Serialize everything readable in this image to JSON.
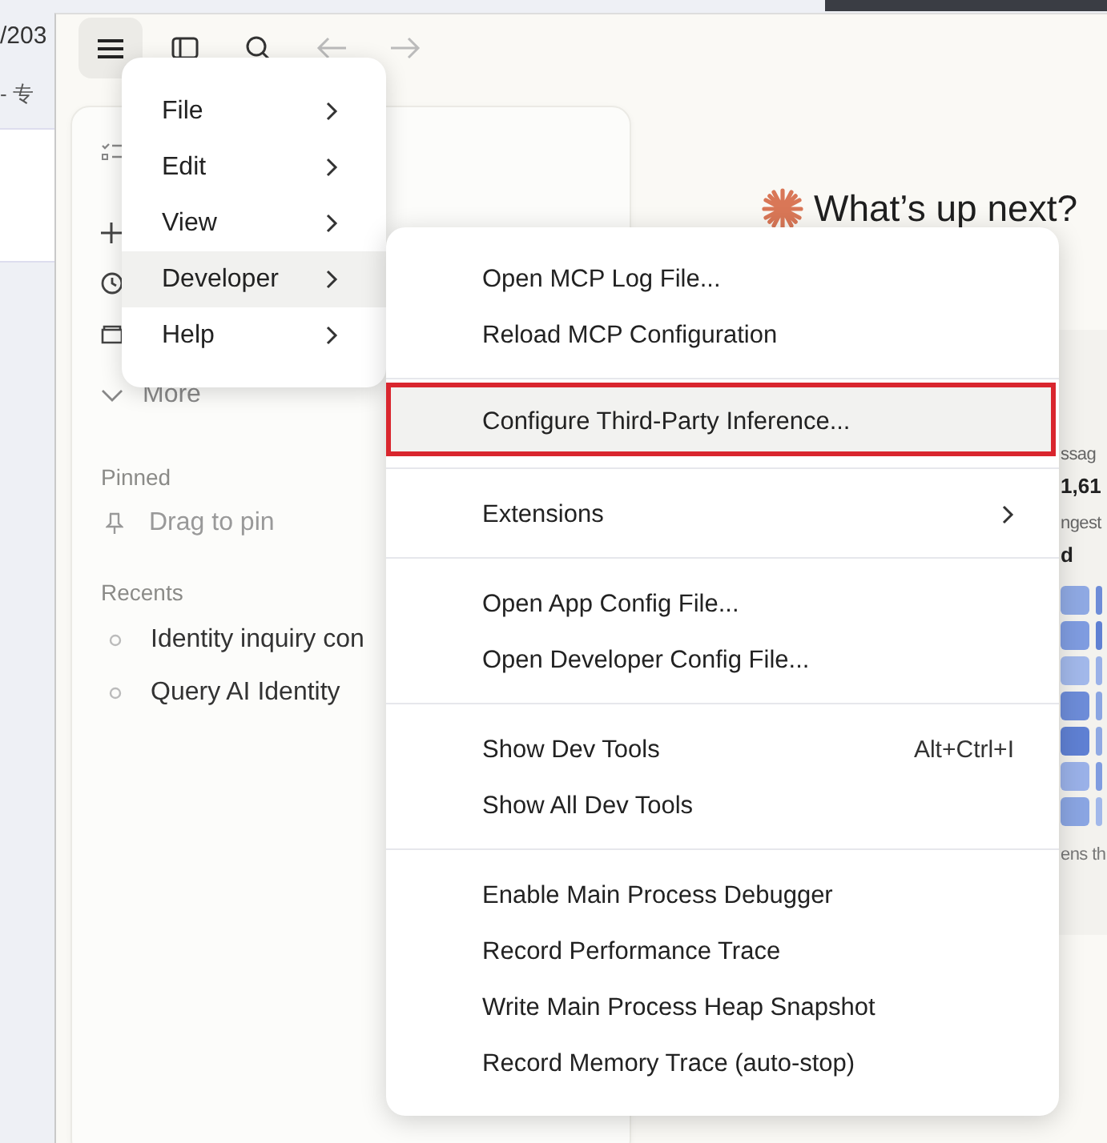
{
  "browser_background": {
    "url_fragment": "/203",
    "tab_fragment": "- 专"
  },
  "sidebar": {
    "more": {
      "label": "More"
    },
    "pinned": {
      "title": "Pinned",
      "hint": "Drag to pin"
    },
    "recents": {
      "title": "Recents",
      "items": [
        {
          "label": "Identity inquiry con"
        },
        {
          "label": "Query AI Identity"
        }
      ]
    }
  },
  "main": {
    "greeting": "What’s up next?",
    "stats_fragments": [
      {
        "text": "ssag",
        "kind": "label"
      },
      {
        "text": "1,61",
        "kind": "value"
      },
      {
        "text": "ngest",
        "kind": "label"
      },
      {
        "text": "d",
        "kind": "value"
      },
      {
        "kind": "heatmap"
      },
      {
        "text": "ens th",
        "kind": "note"
      }
    ]
  },
  "app_menu": {
    "items": [
      {
        "label": "File",
        "selected": false
      },
      {
        "label": "Edit",
        "selected": false
      },
      {
        "label": "View",
        "selected": false
      },
      {
        "label": "Developer",
        "selected": true
      },
      {
        "label": "Help",
        "selected": false
      }
    ]
  },
  "developer_submenu": {
    "groups": [
      {
        "items": [
          {
            "label": "Open MCP Log File...",
            "highlighted": false
          },
          {
            "label": "Reload MCP Configuration",
            "highlighted": false
          }
        ]
      },
      {
        "items": [
          {
            "label": "Configure Third-Party Inference...",
            "highlighted": true
          }
        ]
      },
      {
        "items": [
          {
            "label": "Extensions",
            "highlighted": false,
            "submenu": true
          }
        ]
      },
      {
        "items": [
          {
            "label": "Open App Config File...",
            "highlighted": false
          },
          {
            "label": "Open Developer Config File...",
            "highlighted": false
          }
        ]
      },
      {
        "items": [
          {
            "label": "Show Dev Tools",
            "shortcut": "Alt+Ctrl+I",
            "highlighted": false
          },
          {
            "label": "Show All Dev Tools",
            "highlighted": false
          }
        ]
      },
      {
        "items": [
          {
            "label": "Enable Main Process Debugger",
            "highlighted": false
          },
          {
            "label": "Record Performance Trace",
            "highlighted": false
          },
          {
            "label": "Write Main Process Heap Snapshot",
            "highlighted": false
          },
          {
            "label": "Record Memory Trace (auto-stop)",
            "highlighted": false
          }
        ]
      }
    ]
  }
}
